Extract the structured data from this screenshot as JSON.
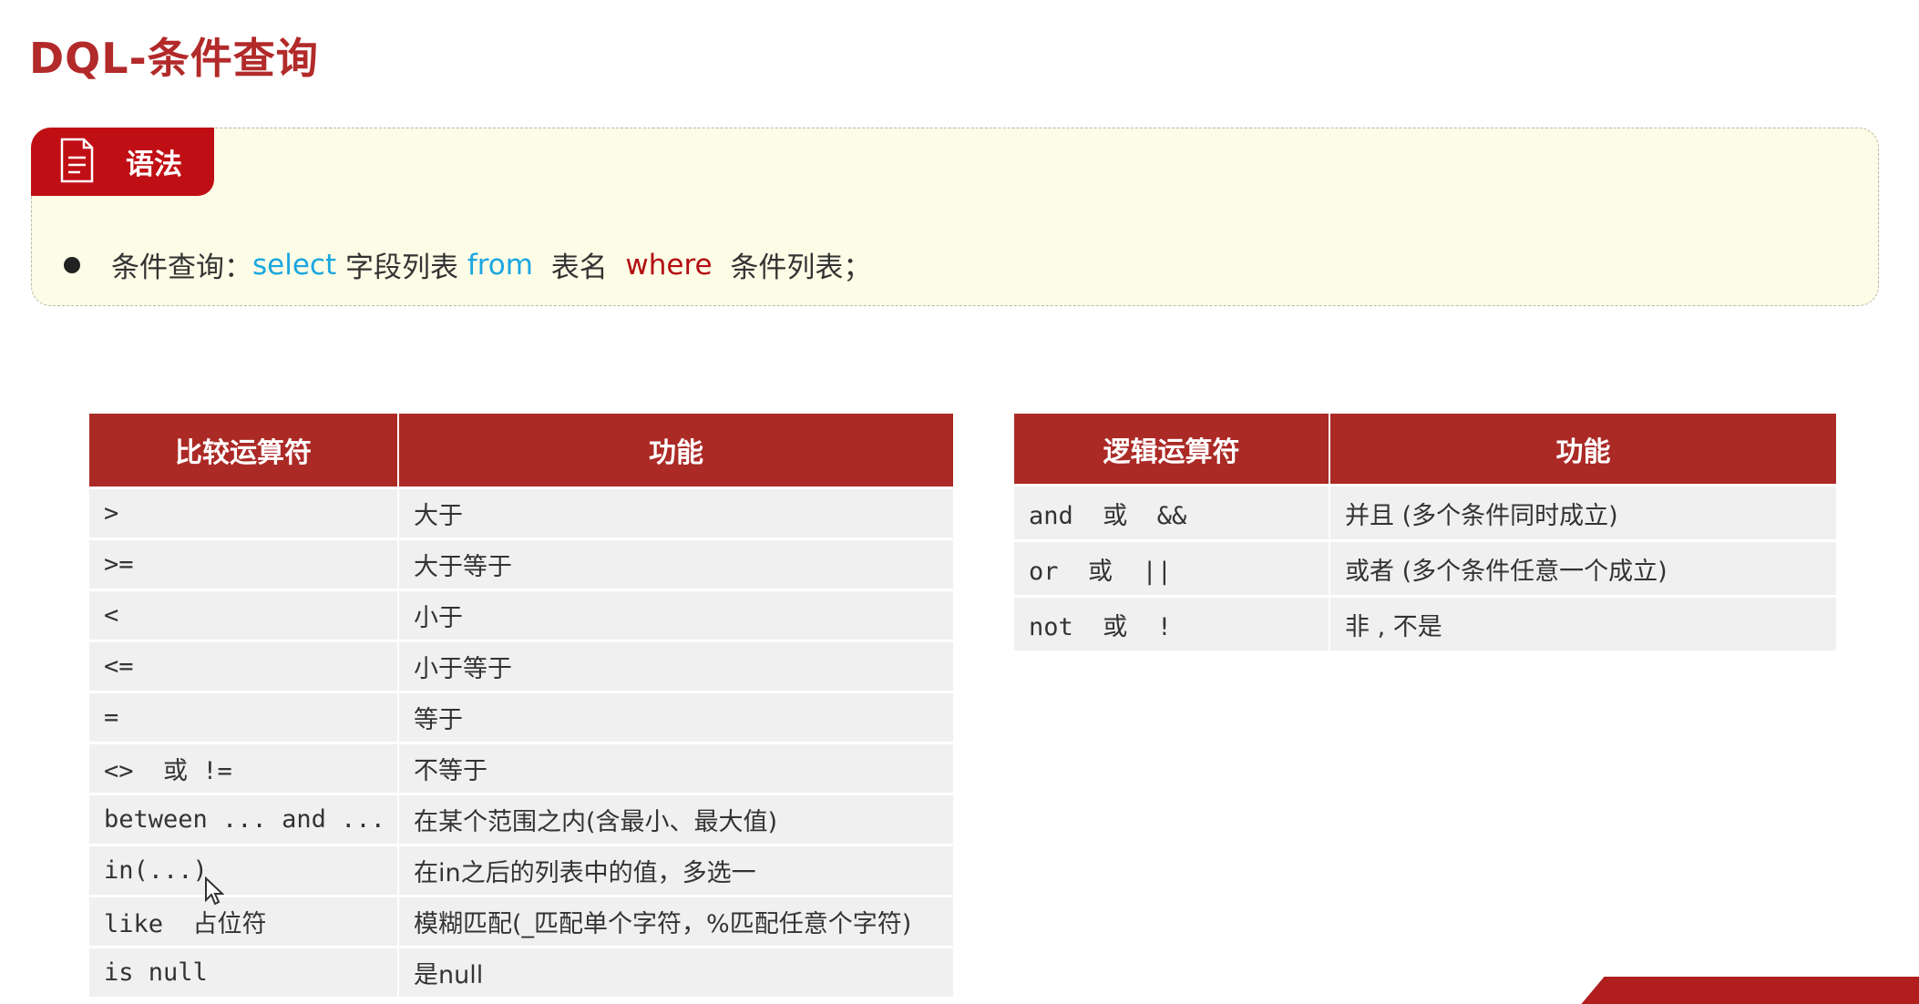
{
  "title": "DQL-条件查询",
  "syntax": {
    "tag_label": "语法",
    "prefix": "条件查询：",
    "kw_select": "select",
    "field_list": " 字段列表 ",
    "kw_from": "from",
    "table_name": "  表名  ",
    "kw_where": "where",
    "condition_list": "  条件列表；",
    "colors": {
      "keyword_blue": "#1aa7e0",
      "keyword_red": "#b30d12",
      "accent": "#ab2a26"
    }
  },
  "comparison_table": {
    "headers": [
      "比较运算符",
      "功能"
    ],
    "rows": [
      [
        ">",
        "大于"
      ],
      [
        ">=",
        "大于等于"
      ],
      [
        "<",
        "小于"
      ],
      [
        "<=",
        "小于等于"
      ],
      [
        "=",
        "等于"
      ],
      [
        "<>  或 !=",
        "不等于"
      ],
      [
        "between ... and ...",
        "在某个范围之内(含最小、最大值)"
      ],
      [
        "in(...)",
        "在in之后的列表中的值，多选一"
      ],
      [
        "like  占位符",
        "模糊匹配(_匹配单个字符，%匹配任意个字符)"
      ],
      [
        "is null",
        "是null"
      ]
    ]
  },
  "logic_table": {
    "headers": [
      "逻辑运算符",
      "功能"
    ],
    "rows": [
      [
        "and  或  &&",
        "并且 (多个条件同时成立)"
      ],
      [
        "or  或  ||",
        "或者 (多个条件任意一个成立)"
      ],
      [
        "not  或  !",
        "非 , 不是"
      ]
    ]
  }
}
